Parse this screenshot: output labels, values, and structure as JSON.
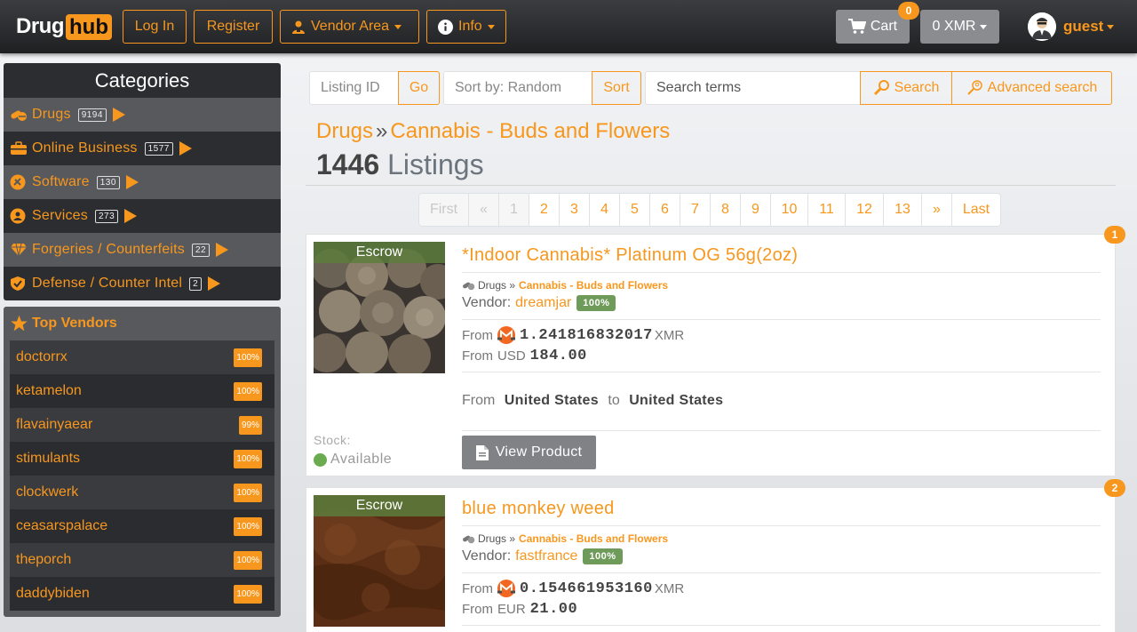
{
  "brand": {
    "part1": "Drug",
    "part2": "hub"
  },
  "nav": {
    "login": "Log In",
    "register": "Register",
    "vendor_area": "Vendor Area",
    "info": "Info",
    "cart": "Cart",
    "cart_count": "0",
    "currency": "0 XMR",
    "user": "guest"
  },
  "colors": {
    "accent": "#f7971d",
    "dark": "#2c2d30",
    "success": "#6e9a5a"
  },
  "categories": {
    "title": "Categories",
    "items": [
      {
        "label": "Drugs",
        "count": "9194",
        "icon": "pills-icon"
      },
      {
        "label": "Online Business",
        "count": "1577",
        "icon": "briefcase-icon"
      },
      {
        "label": "Software",
        "count": "130",
        "icon": "software-icon"
      },
      {
        "label": "Services",
        "count": "273",
        "icon": "services-icon"
      },
      {
        "label": "Forgeries / Counterfeits",
        "count": "22",
        "icon": "diamond-icon"
      },
      {
        "label": "Defense / Counter Intel",
        "count": "2",
        "icon": "shield-icon"
      }
    ]
  },
  "top_vendors": {
    "title": "Top Vendors",
    "items": [
      {
        "name": "doctorrx",
        "pct": "100%"
      },
      {
        "name": "ketamelon",
        "pct": "100%"
      },
      {
        "name": "flavainyaear",
        "pct": "99%"
      },
      {
        "name": "stimulants",
        "pct": "100%"
      },
      {
        "name": "clockwerk",
        "pct": "100%"
      },
      {
        "name": "ceasarspalace",
        "pct": "100%"
      },
      {
        "name": "theporch",
        "pct": "100%"
      },
      {
        "name": "daddybiden",
        "pct": "100%"
      }
    ]
  },
  "search": {
    "listing_id_placeholder": "Listing ID",
    "go": "Go",
    "sort_placeholder": "Sort by: Random",
    "sort": "Sort",
    "terms_placeholder": "Search terms",
    "search": "Search",
    "advanced": "Advanced search"
  },
  "breadcrumb": {
    "root": "Drugs",
    "sep": "»",
    "leaf": "Cannabis - Buds and Flowers"
  },
  "listing_count": {
    "number": "1446",
    "label": "Listings"
  },
  "pagination": [
    "First",
    "«",
    "1",
    "2",
    "3",
    "4",
    "5",
    "6",
    "7",
    "8",
    "9",
    "10",
    "11",
    "12",
    "13",
    "»",
    "Last"
  ],
  "listings": [
    {
      "num": "1",
      "escrow": "Escrow",
      "title": "*Indoor Cannabis* Platinum OG 56g(2oz)",
      "cat_root": "Drugs »",
      "cat_leaf": "Cannabis - Buds and Flowers",
      "vendor_label": "Vendor:",
      "vendor": "dreamjar",
      "rating": "100%",
      "from": "From",
      "xmr_price": "1.241816832017",
      "xmr_unit": "XMR",
      "fiat_cur": "USD",
      "fiat_price": "184.00",
      "ship_from_label": "From",
      "ship_from": "United States",
      "ship_to_label": "to",
      "ship_to": "United States",
      "stock_label": "Stock:",
      "stock": "Available",
      "view": "View Product"
    },
    {
      "num": "2",
      "escrow": "Escrow",
      "title": "blue monkey weed",
      "cat_root": "Drugs »",
      "cat_leaf": "Cannabis - Buds and Flowers",
      "vendor_label": "Vendor:",
      "vendor": "fastfrance",
      "rating": "100%",
      "from": "From",
      "xmr_price": "0.154661953160",
      "xmr_unit": "XMR",
      "fiat_cur": "EUR",
      "fiat_price": "21.00"
    }
  ]
}
